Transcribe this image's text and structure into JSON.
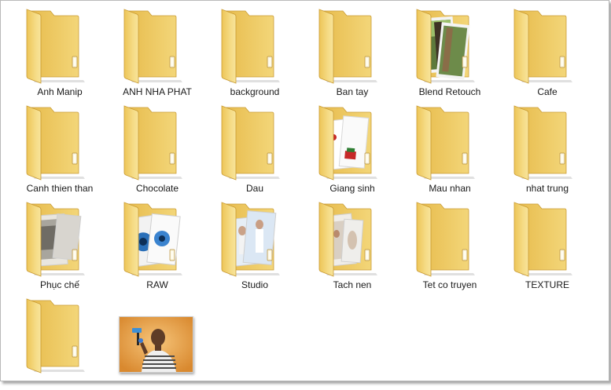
{
  "window": {
    "background": "#ffffff",
    "folder_color": "#f2cf6b"
  },
  "folders": [
    {
      "label": "Anh Manip",
      "preview": "none"
    },
    {
      "label": "ANH NHA PHAT",
      "preview": "none"
    },
    {
      "label": "background",
      "preview": "none"
    },
    {
      "label": "Ban tay",
      "preview": "none"
    },
    {
      "label": "Blend Retouch",
      "preview": "forest-photos"
    },
    {
      "label": "Cafe",
      "preview": "none"
    },
    {
      "label": "Canh thien than",
      "preview": "none"
    },
    {
      "label": "Chocolate",
      "preview": "none"
    },
    {
      "label": "Dau",
      "preview": "none"
    },
    {
      "label": "Giang sinh",
      "preview": "christmas-cards"
    },
    {
      "label": "Mau nhan",
      "preview": "none"
    },
    {
      "label": "nhat trung",
      "preview": "none"
    },
    {
      "label": "Phục chế",
      "preview": "old-photos"
    },
    {
      "label": "RAW",
      "preview": "raw-file-icons"
    },
    {
      "label": "Studio",
      "preview": "studio-portraits"
    },
    {
      "label": "Tach nen",
      "preview": "portrait-photos"
    },
    {
      "label": "Tet co truyen",
      "preview": "none"
    },
    {
      "label": "TEXTURE",
      "preview": "none"
    },
    {
      "label": "",
      "preview": "none"
    }
  ],
  "image_file": {
    "label": "",
    "depicts": "man-holding-camera-stabilizer"
  }
}
